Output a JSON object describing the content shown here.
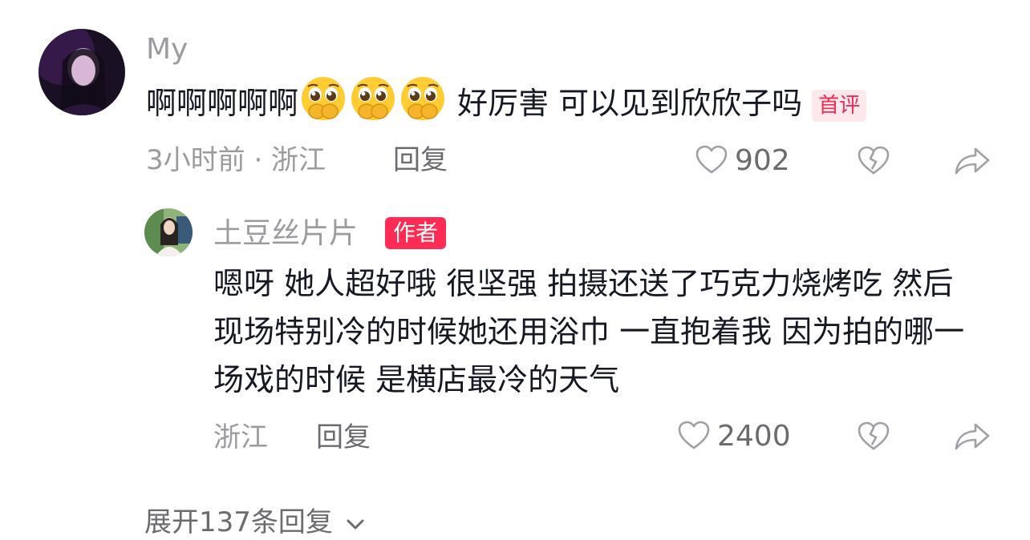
{
  "comment": {
    "username": "My",
    "text_before": "啊啊啊啊啊",
    "emoji_count": 3,
    "emoji_name": "pleading-face-covering-mouth-icon",
    "text_after": " 好厉害 可以见到欣欣子吗",
    "badge": "首评",
    "time": "3小时前 · 浙江",
    "reply_label": "回复",
    "likes": "902"
  },
  "reply": {
    "username": "土豆丝片片",
    "badge": "作者",
    "text": "嗯呀 她人超好哦 很坚强 拍摄还送了巧克力烧烤吃 然后现场特别冷的时候她还用浴巾 一直抱着我 因为拍的哪一场戏的时候 是横店最冷的天气",
    "location": "浙江",
    "reply_label": "回复",
    "likes": "2400"
  },
  "expand_label": "展开137条回复",
  "colors": {
    "accent": "#fe2c55",
    "muted": "#9b9ba0",
    "text": "#161823"
  }
}
